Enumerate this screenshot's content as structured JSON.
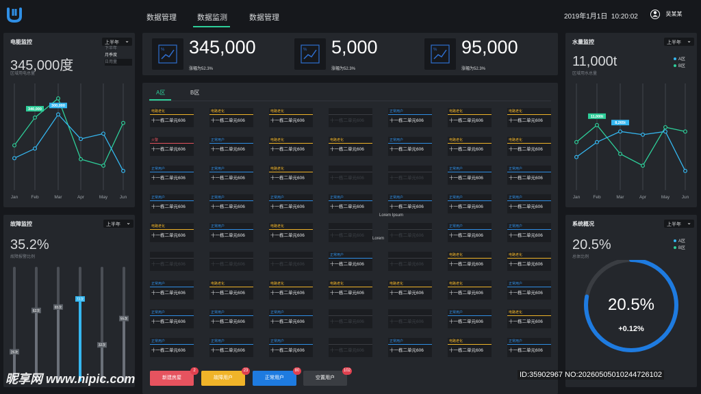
{
  "header": {
    "nav": [
      "数据管理",
      "数据监测",
      "数据管理"
    ],
    "active_index": 1,
    "datetime": "2019年1月1日  10:20:02",
    "user": "吴某某"
  },
  "power": {
    "title": "电能监控",
    "select": "上半年",
    "options": [
      "下半年",
      "月季度",
      "日用量"
    ],
    "value": "345,000度",
    "caption": "区域用电总量",
    "labels": [
      "340,000",
      "300,000"
    ]
  },
  "fault": {
    "title": "故障监控",
    "select": "上半年",
    "value": "35.2%",
    "caption": "故障报警比例"
  },
  "water": {
    "title": "水量监控",
    "select": "上半年",
    "value": "11,000t",
    "caption": "区域用水总量",
    "legend": [
      "A区",
      "B区"
    ],
    "labels": [
      "11,000t",
      "8,265t"
    ]
  },
  "system": {
    "title": "系统概况",
    "select": "上半年",
    "value": "20.5%",
    "caption": "总体比例",
    "legend": [
      "A区",
      "B区"
    ],
    "gauge_value": "20.5%",
    "gauge_delta": "+0.12%",
    "gauge_fraction": 0.78
  },
  "kpis": [
    {
      "value": "345,000",
      "sub": "涨幅为52.3%"
    },
    {
      "value": "5,000",
      "sub": "涨幅为52.3%"
    },
    {
      "value": "95,000",
      "sub": "涨幅为52.3%"
    }
  ],
  "tabs": [
    "A区",
    "B区"
  ],
  "card_text": "十一栋二单元606",
  "grid_overlay": [
    "Lorem Ipsum",
    "Lorem"
  ],
  "buttons": [
    {
      "label": "新建房屋",
      "badge": "2",
      "color": "#e6535f"
    },
    {
      "label": "故障用户",
      "badge": "23",
      "color": "#f0b429"
    },
    {
      "label": "正常用户",
      "badge": "80",
      "color": "#1e7be0"
    },
    {
      "label": "空置用户",
      "badge": "102",
      "color": "#3a3d42"
    }
  ],
  "watermark": {
    "logo": "昵享网 www.nipic.com",
    "id": "ID:35902967 NO:20260505010244726102"
  },
  "chart_data": [
    {
      "type": "line",
      "title": "电能监控",
      "categories": [
        "Jan",
        "Feb",
        "Mar",
        "Apr",
        "May",
        "Jun"
      ],
      "series": [
        {
          "values": [
            0.42,
            0.68,
            0.86,
            0.29,
            0.23,
            0.63
          ]
        },
        {
          "values": [
            0.3,
            0.39,
            0.71,
            0.48,
            0.53,
            0.18
          ]
        }
      ],
      "ylim": [
        0,
        1
      ]
    },
    {
      "type": "line",
      "title": "水量监控",
      "categories": [
        "Jan",
        "Feb",
        "Mar",
        "Apr",
        "May",
        "Jun"
      ],
      "series": [
        {
          "values": [
            0.45,
            0.61,
            0.34,
            0.23,
            0.59,
            0.55
          ]
        },
        {
          "values": [
            0.31,
            0.45,
            0.55,
            0.52,
            0.55,
            0.18
          ]
        }
      ],
      "ylim": [
        0,
        1
      ]
    },
    {
      "type": "bar",
      "title": "故障监控",
      "categories": [
        "",
        "",
        "",
        "",
        "",
        ""
      ],
      "values": [
        26,
        62,
        65,
        72,
        32,
        55
      ],
      "value_labels": [
        "26次",
        "62次",
        "65次",
        "72次",
        "32次",
        "55次"
      ],
      "ylim": [
        0,
        100
      ]
    }
  ]
}
